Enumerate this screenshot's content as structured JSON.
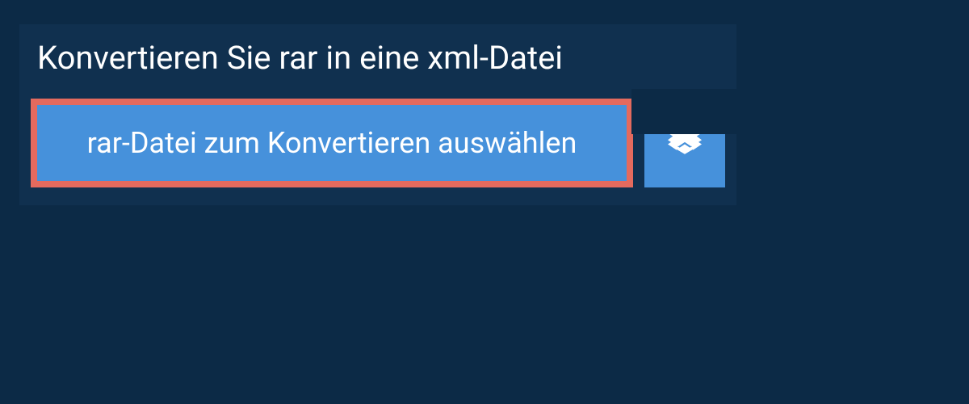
{
  "title": "Konvertieren Sie rar in eine xml-Datei",
  "select_file_label": "rar-Datei zum Konvertieren auswählen",
  "colors": {
    "page_bg": "#0c2a46",
    "panel_bg": "#10304f",
    "button_bg": "#4691db",
    "highlight_border": "#e46a5e",
    "text": "#ffffff"
  },
  "icons": {
    "dropbox": "dropbox-icon"
  }
}
